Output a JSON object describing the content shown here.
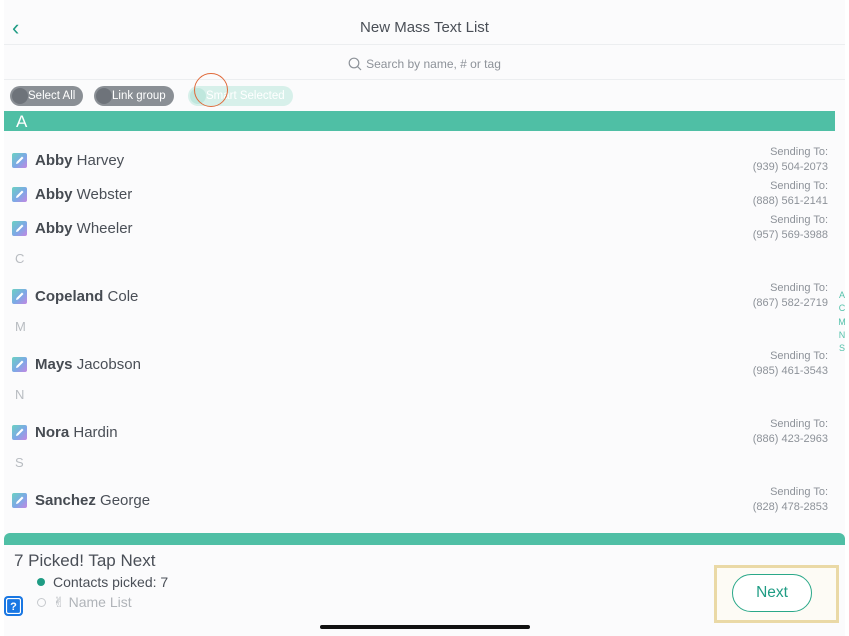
{
  "header": {
    "title": "New Mass Text List",
    "back_glyph": "‹",
    "search_placeholder": "Search by name, # or tag"
  },
  "chips": [
    {
      "label": "Select All",
      "state": "off"
    },
    {
      "label": "Link group",
      "state": "off"
    },
    {
      "label": "Smart Selected",
      "state": "active"
    }
  ],
  "section_bar_letter": "A",
  "sending_label": "Sending To:",
  "contacts": [
    {
      "first": "Abby",
      "last": "Harvey",
      "phone": "(939) 504-2073"
    },
    {
      "first": "Abby",
      "last": "Webster",
      "phone": "(888) 561-2141"
    },
    {
      "first": "Abby",
      "last": "Wheeler",
      "phone": "(957) 569-3988"
    },
    {
      "section": "C"
    },
    {
      "first": "Copeland",
      "last": "Cole",
      "phone": "(867) 582-2719"
    },
    {
      "section": "M"
    },
    {
      "first": "Mays",
      "last": "Jacobson",
      "phone": "(985) 461-3543"
    },
    {
      "section": "N"
    },
    {
      "first": "Nora",
      "last": "Hardin",
      "phone": "(886) 423-2963"
    },
    {
      "section": "S"
    },
    {
      "first": "Sanchez",
      "last": "George",
      "phone": "(828) 478-2853"
    }
  ],
  "index_letters": [
    "A",
    "C",
    "M",
    "N",
    "S"
  ],
  "footer": {
    "picked_title": "7 Picked! Tap Next",
    "contacts_picked": "Contacts picked: 7",
    "name_list": "✌ Name List",
    "next_label": "Next"
  },
  "colors": {
    "accent": "#4fbfa5",
    "accent_dark": "#1f9c84",
    "help_blue": "#1977e3"
  },
  "icons": {
    "back": "chevron-left-icon",
    "search": "search-icon",
    "edit": "edit-pencil-icon",
    "help": "help-icon"
  }
}
